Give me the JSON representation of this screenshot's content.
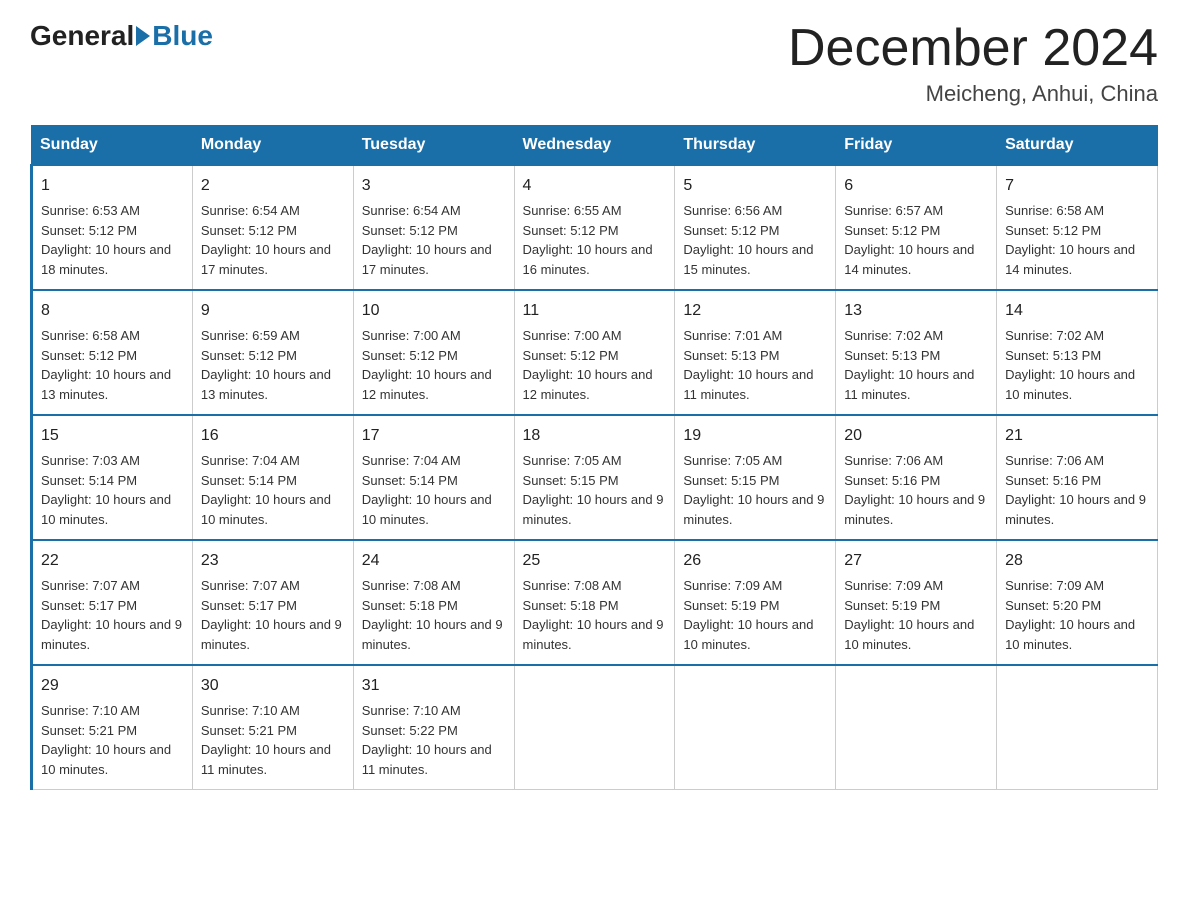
{
  "logo": {
    "general": "General",
    "blue": "Blue"
  },
  "header": {
    "month_year": "December 2024",
    "location": "Meicheng, Anhui, China"
  },
  "weekdays": [
    "Sunday",
    "Monday",
    "Tuesday",
    "Wednesday",
    "Thursday",
    "Friday",
    "Saturday"
  ],
  "weeks": [
    [
      {
        "day": "1",
        "sunrise": "6:53 AM",
        "sunset": "5:12 PM",
        "daylight": "10 hours and 18 minutes."
      },
      {
        "day": "2",
        "sunrise": "6:54 AM",
        "sunset": "5:12 PM",
        "daylight": "10 hours and 17 minutes."
      },
      {
        "day": "3",
        "sunrise": "6:54 AM",
        "sunset": "5:12 PM",
        "daylight": "10 hours and 17 minutes."
      },
      {
        "day": "4",
        "sunrise": "6:55 AM",
        "sunset": "5:12 PM",
        "daylight": "10 hours and 16 minutes."
      },
      {
        "day": "5",
        "sunrise": "6:56 AM",
        "sunset": "5:12 PM",
        "daylight": "10 hours and 15 minutes."
      },
      {
        "day": "6",
        "sunrise": "6:57 AM",
        "sunset": "5:12 PM",
        "daylight": "10 hours and 14 minutes."
      },
      {
        "day": "7",
        "sunrise": "6:58 AM",
        "sunset": "5:12 PM",
        "daylight": "10 hours and 14 minutes."
      }
    ],
    [
      {
        "day": "8",
        "sunrise": "6:58 AM",
        "sunset": "5:12 PM",
        "daylight": "10 hours and 13 minutes."
      },
      {
        "day": "9",
        "sunrise": "6:59 AM",
        "sunset": "5:12 PM",
        "daylight": "10 hours and 13 minutes."
      },
      {
        "day": "10",
        "sunrise": "7:00 AM",
        "sunset": "5:12 PM",
        "daylight": "10 hours and 12 minutes."
      },
      {
        "day": "11",
        "sunrise": "7:00 AM",
        "sunset": "5:12 PM",
        "daylight": "10 hours and 12 minutes."
      },
      {
        "day": "12",
        "sunrise": "7:01 AM",
        "sunset": "5:13 PM",
        "daylight": "10 hours and 11 minutes."
      },
      {
        "day": "13",
        "sunrise": "7:02 AM",
        "sunset": "5:13 PM",
        "daylight": "10 hours and 11 minutes."
      },
      {
        "day": "14",
        "sunrise": "7:02 AM",
        "sunset": "5:13 PM",
        "daylight": "10 hours and 10 minutes."
      }
    ],
    [
      {
        "day": "15",
        "sunrise": "7:03 AM",
        "sunset": "5:14 PM",
        "daylight": "10 hours and 10 minutes."
      },
      {
        "day": "16",
        "sunrise": "7:04 AM",
        "sunset": "5:14 PM",
        "daylight": "10 hours and 10 minutes."
      },
      {
        "day": "17",
        "sunrise": "7:04 AM",
        "sunset": "5:14 PM",
        "daylight": "10 hours and 10 minutes."
      },
      {
        "day": "18",
        "sunrise": "7:05 AM",
        "sunset": "5:15 PM",
        "daylight": "10 hours and 9 minutes."
      },
      {
        "day": "19",
        "sunrise": "7:05 AM",
        "sunset": "5:15 PM",
        "daylight": "10 hours and 9 minutes."
      },
      {
        "day": "20",
        "sunrise": "7:06 AM",
        "sunset": "5:16 PM",
        "daylight": "10 hours and 9 minutes."
      },
      {
        "day": "21",
        "sunrise": "7:06 AM",
        "sunset": "5:16 PM",
        "daylight": "10 hours and 9 minutes."
      }
    ],
    [
      {
        "day": "22",
        "sunrise": "7:07 AM",
        "sunset": "5:17 PM",
        "daylight": "10 hours and 9 minutes."
      },
      {
        "day": "23",
        "sunrise": "7:07 AM",
        "sunset": "5:17 PM",
        "daylight": "10 hours and 9 minutes."
      },
      {
        "day": "24",
        "sunrise": "7:08 AM",
        "sunset": "5:18 PM",
        "daylight": "10 hours and 9 minutes."
      },
      {
        "day": "25",
        "sunrise": "7:08 AM",
        "sunset": "5:18 PM",
        "daylight": "10 hours and 9 minutes."
      },
      {
        "day": "26",
        "sunrise": "7:09 AM",
        "sunset": "5:19 PM",
        "daylight": "10 hours and 10 minutes."
      },
      {
        "day": "27",
        "sunrise": "7:09 AM",
        "sunset": "5:19 PM",
        "daylight": "10 hours and 10 minutes."
      },
      {
        "day": "28",
        "sunrise": "7:09 AM",
        "sunset": "5:20 PM",
        "daylight": "10 hours and 10 minutes."
      }
    ],
    [
      {
        "day": "29",
        "sunrise": "7:10 AM",
        "sunset": "5:21 PM",
        "daylight": "10 hours and 10 minutes."
      },
      {
        "day": "30",
        "sunrise": "7:10 AM",
        "sunset": "5:21 PM",
        "daylight": "10 hours and 11 minutes."
      },
      {
        "day": "31",
        "sunrise": "7:10 AM",
        "sunset": "5:22 PM",
        "daylight": "10 hours and 11 minutes."
      },
      null,
      null,
      null,
      null
    ]
  ],
  "labels": {
    "sunrise": "Sunrise:",
    "sunset": "Sunset:",
    "daylight": "Daylight:"
  }
}
